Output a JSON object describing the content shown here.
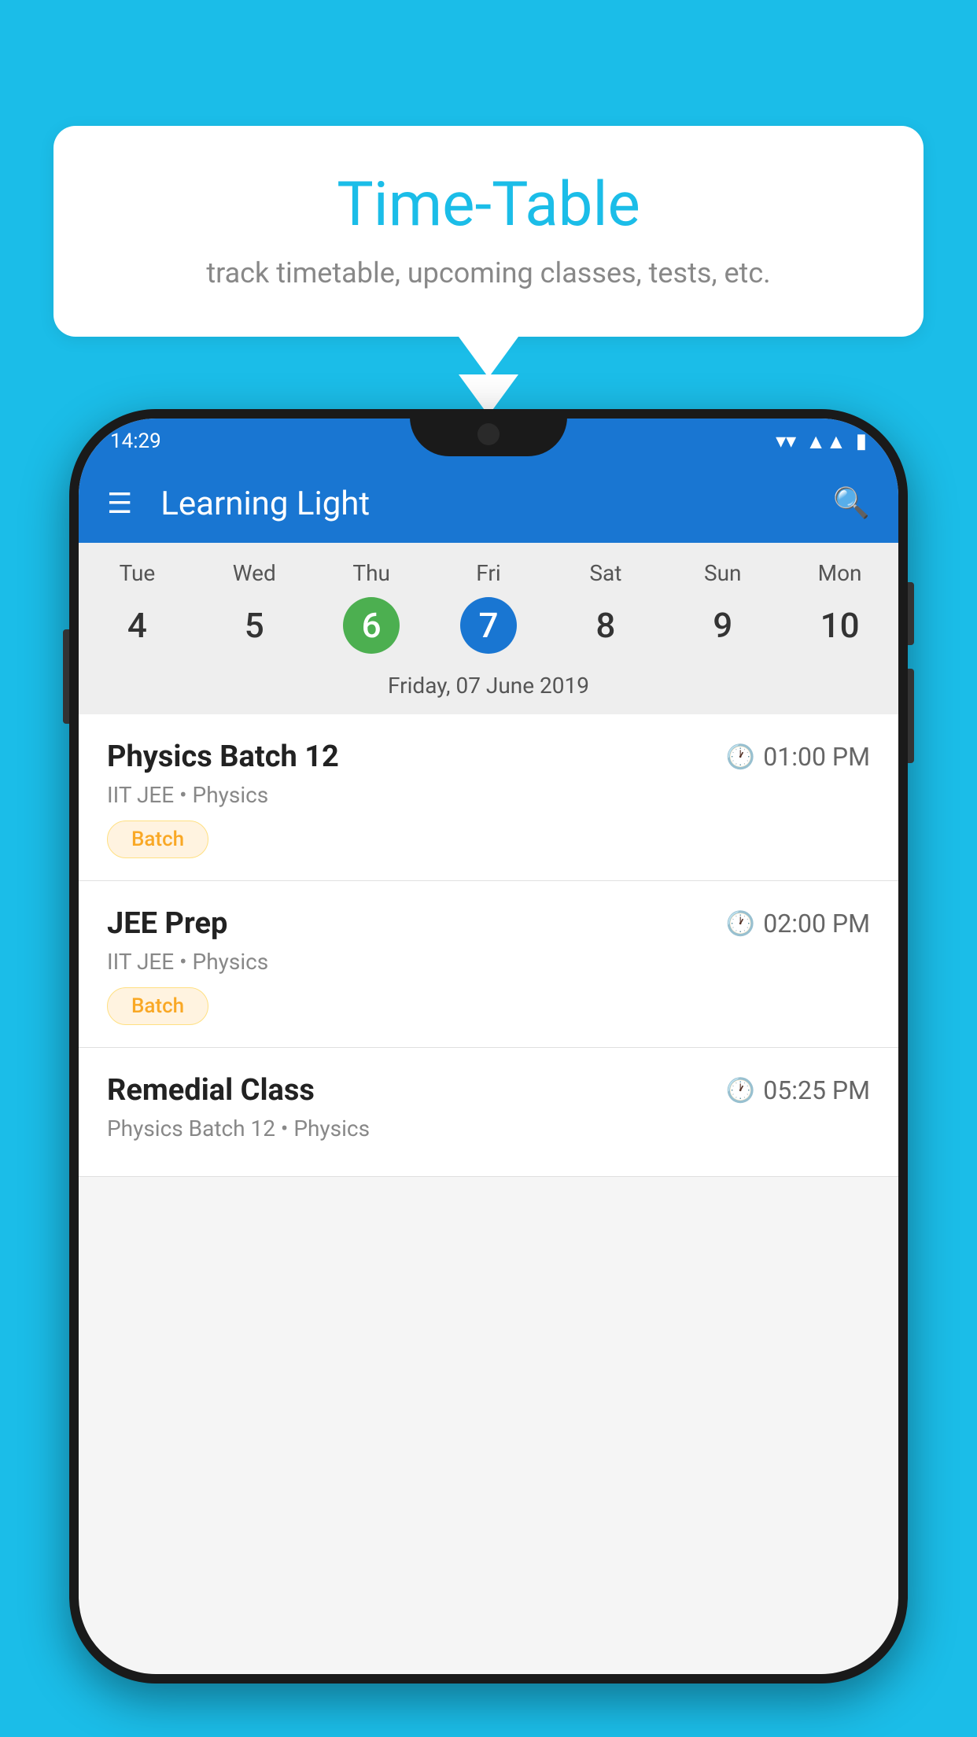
{
  "background_color": "#1bbde8",
  "bubble": {
    "title": "Time-Table",
    "subtitle": "track timetable, upcoming classes, tests, etc."
  },
  "phone": {
    "status_bar": {
      "time": "14:29"
    },
    "app_bar": {
      "title": "Learning Light"
    },
    "calendar": {
      "days": [
        {
          "name": "Tue",
          "num": "4",
          "state": "normal"
        },
        {
          "name": "Wed",
          "num": "5",
          "state": "normal"
        },
        {
          "name": "Thu",
          "num": "6",
          "state": "today"
        },
        {
          "name": "Fri",
          "num": "7",
          "state": "selected"
        },
        {
          "name": "Sat",
          "num": "8",
          "state": "normal"
        },
        {
          "name": "Sun",
          "num": "9",
          "state": "normal"
        },
        {
          "name": "Mon",
          "num": "10",
          "state": "normal"
        }
      ],
      "selected_date_label": "Friday, 07 June 2019"
    },
    "schedule": [
      {
        "title": "Physics Batch 12",
        "time": "01:00 PM",
        "meta": "IIT JEE • Physics",
        "badge": "Batch"
      },
      {
        "title": "JEE Prep",
        "time": "02:00 PM",
        "meta": "IIT JEE • Physics",
        "badge": "Batch"
      },
      {
        "title": "Remedial Class",
        "time": "05:25 PM",
        "meta": "Physics Batch 12 • Physics",
        "badge": null
      }
    ]
  }
}
